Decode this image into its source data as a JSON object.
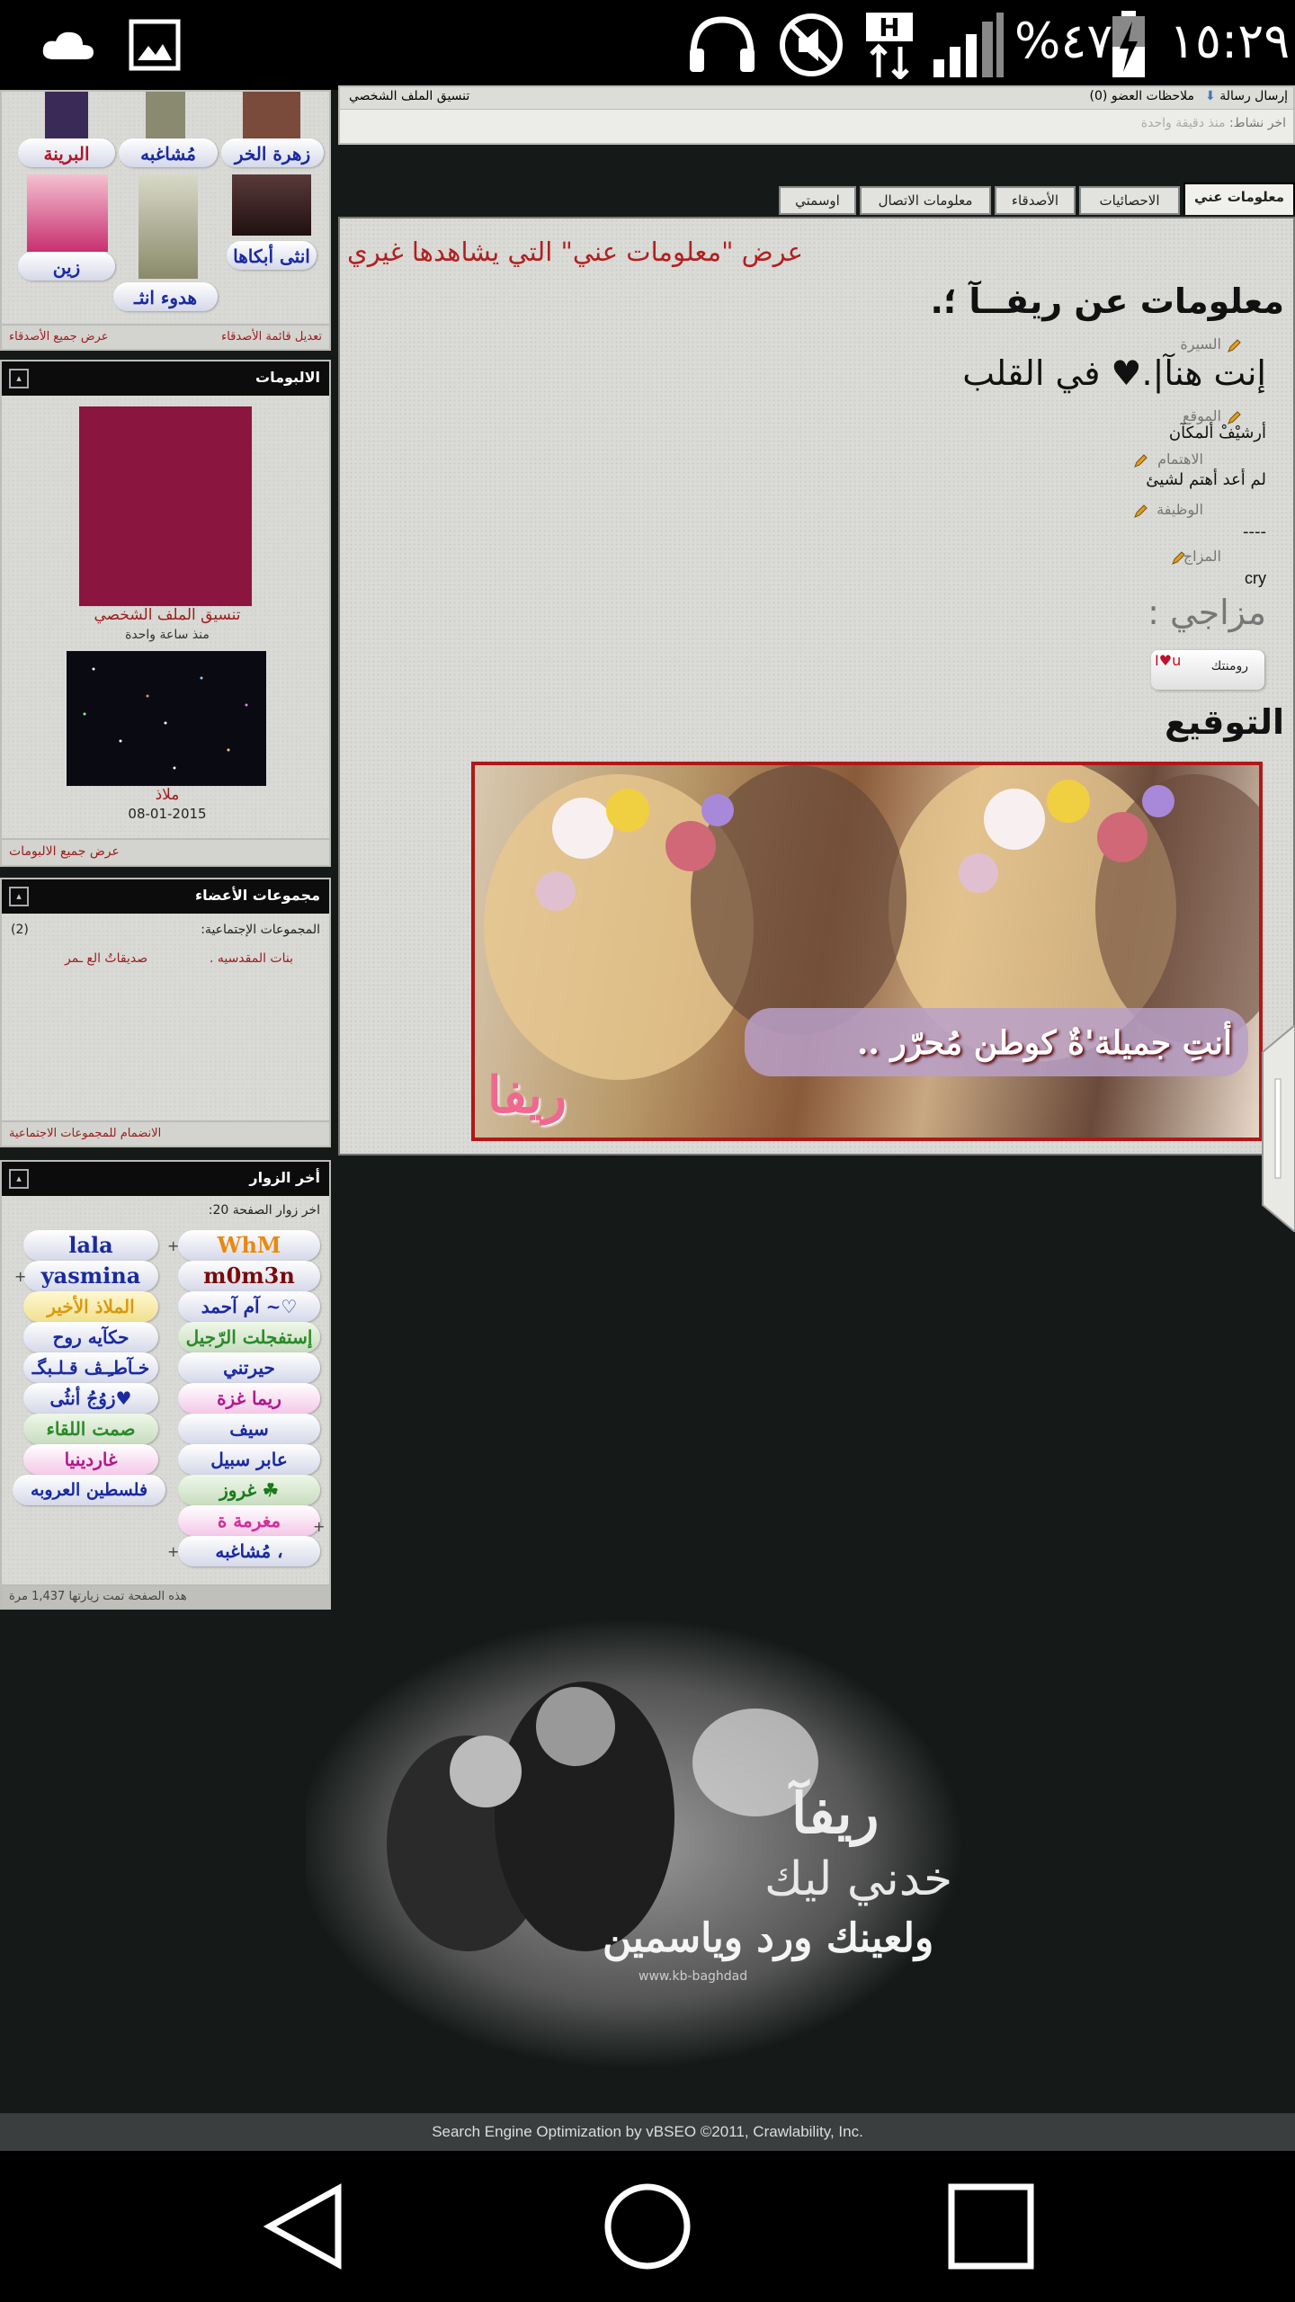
{
  "status_bar": {
    "time": "١٥:٢٩",
    "battery": "%٤٧",
    "network": "H"
  },
  "friends_panel": {
    "friends": [
      "زهرة الخر",
      "مُشاغبه",
      "البرينة",
      "انثى أبكاها",
      "هدوء انثـ",
      "زين"
    ],
    "footer_left": "عرض جميع الأصدقاء",
    "footer_right": "تعديل قائمة الأصدقاء"
  },
  "albums_panel": {
    "title": "الالبومات",
    "album1_title": "تنسيق الملف الشخصي",
    "album1_time": "منذ ساعة واحدة",
    "album2_title": "ملاذ",
    "album2_date": "08-01-2015",
    "footer": "عرض جميع الالبومات"
  },
  "groups_panel": {
    "title": "مجموعات الأعضاء",
    "label": "المجموعات الإجتماعية:",
    "count": "(2)",
    "group1": "بنات المقدسيه .",
    "group2": "صديقاتٌ الع ـمر",
    "footer": "الانضمام للمجموعات الاجتماعية"
  },
  "visitors_panel": {
    "title": "أخر الزوار",
    "label": "اخر زوار الصفحة 20:",
    "visitors": [
      "WhM",
      "lala",
      "m0m3n",
      "yasmina",
      "آم آحمد ~♡",
      "الملاذ الأخير",
      "إستفجلت الرّجيل",
      "حكآيه روح",
      "حيرتني",
      "خـآطـِـڤ قـلـبگـ",
      "ريما غزة",
      "زوُجُ أنثُى♥",
      "سيف",
      "صمت اللقاء",
      "عابر سبيل",
      "غاردينيا",
      "غروز ☘",
      "فلسطين العروبه",
      "مغرمة ة",
      "مُشاغبه ،"
    ],
    "footer": "هذه الصفحة تمت زيارتها 1,437 مرة"
  },
  "top_bar": {
    "send_message": "إرسال رسالة",
    "member_notes": "ملاحظات العضو (0)",
    "profile_style": "تنسيق الملف الشخصي",
    "last_activity_label": "اخر نشاط:",
    "last_activity_value": "منذ دقيقة واحدة"
  },
  "tabs": [
    "معلومات عني",
    "الاحصائيات",
    "الأصدقاء",
    "معلومات الاتصال",
    "اوسمتي"
  ],
  "profile": {
    "view_notice": "عرض \"معلومات عني\" التي يشاهدها غيري",
    "about_title": "معلومات عن ريفــآ ؛.",
    "bio_label": "السيرة",
    "bio_value": "إنت هنآ|.♥ في القلب",
    "location_label": "الموقع",
    "location_value": "أرشيْفْ ألمكآن",
    "interest_label": "الاهتمام",
    "interest_value": "لم أعد أهتم لشيئ",
    "job_label": "الوظيفة",
    "job_value": "----",
    "mood_label": "المزاج",
    "mood_value": "cry",
    "my_mood": "مزاجي :",
    "mood_badge": "رومنتك",
    "signature_title": "التوقيع",
    "signature_text": "أنتِ جميلة'ةٌ كوطن مُحرّر ..",
    "signature_name": "ريفا"
  },
  "bottom_banner": {
    "line1": "ريفآ",
    "line2": "خدني ليك",
    "line3": "ولعينك ورد وياسمين",
    "watermark": "www.kb-baghdad"
  },
  "footer": {
    "text": "Search Engine Optimization by vBSEO ©2011, Crawlability, Inc."
  },
  "colors": {
    "dark_bg": "#151a19",
    "panel_bg": "#d9d9d6",
    "link_red": "#9b1c1c",
    "notice_red": "#b02020",
    "album_magenta": "#8a1640"
  }
}
